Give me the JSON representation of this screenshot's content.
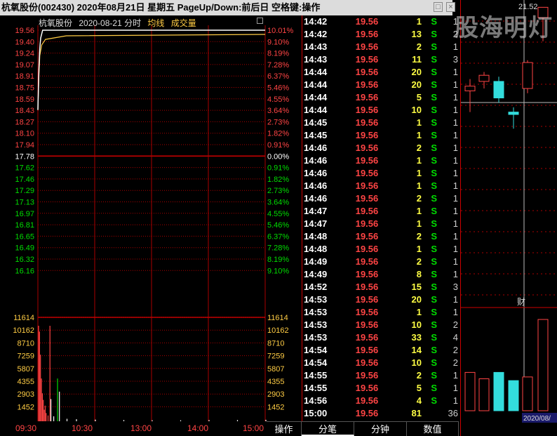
{
  "window": {
    "title": "杭氧股份(002430)  2020年08月21日 星期五 PageUp/Down:前后日 空格键:操作",
    "restore_glyph": "□",
    "close_glyph": "×"
  },
  "chart_header": {
    "stock_name": "杭氧股份",
    "date_label": "2020-08-21 分时",
    "avg_label": "均线",
    "volume_label": "成交量"
  },
  "colors": {
    "up": "#ff4444",
    "down": "#00dd00",
    "flat": "#ffffff",
    "price_line": "#ffffff",
    "avg_line": "#ffcc44",
    "grid": "#aa0000",
    "volume_bar": "#ffffff"
  },
  "price_axis": {
    "left": [
      "19.56",
      "19.40",
      "19.24",
      "19.07",
      "18.91",
      "18.75",
      "18.59",
      "18.43",
      "18.27",
      "18.10",
      "17.94",
      "17.78",
      "17.62",
      "17.46",
      "17.29",
      "17.13",
      "16.97",
      "16.81",
      "16.65",
      "16.49",
      "16.32",
      "16.16"
    ],
    "right": [
      "10.01%",
      "9.10%",
      "8.19%",
      "7.28%",
      "6.37%",
      "5.46%",
      "4.55%",
      "3.64%",
      "2.73%",
      "1.82%",
      "0.91%",
      "0.00%",
      "0.91%",
      "1.82%",
      "2.73%",
      "3.64%",
      "4.55%",
      "5.46%",
      "6.37%",
      "7.28%",
      "8.19%",
      "9.10%"
    ],
    "prev_close_index": 11
  },
  "volume_axis": [
    "11614",
    "10162",
    "8710",
    "7259",
    "5807",
    "4355",
    "2903",
    "1452"
  ],
  "time_axis": [
    "09:30",
    "10:30",
    "13:00",
    "14:00",
    "15:00"
  ],
  "chart_data": {
    "type": "line",
    "price_range": [
      16.0,
      19.56
    ],
    "prev_close": 17.78,
    "price_series": [
      [
        0,
        18.43
      ],
      [
        1,
        19.0
      ],
      [
        2,
        19.3
      ],
      [
        3,
        19.45
      ],
      [
        5,
        19.56
      ],
      [
        240,
        19.56
      ]
    ],
    "avg_series": [
      [
        0,
        18.43
      ],
      [
        1,
        18.9
      ],
      [
        2,
        19.2
      ],
      [
        4,
        19.35
      ],
      [
        8,
        19.43
      ],
      [
        30,
        19.48
      ],
      [
        240,
        19.5
      ]
    ],
    "volume_max": 11614,
    "volume_bars": [
      [
        0,
        11614
      ],
      [
        1,
        10900
      ],
      [
        2,
        8100
      ],
      [
        3,
        5200
      ],
      [
        4,
        3400
      ],
      [
        5,
        2600
      ],
      [
        6,
        1400
      ],
      [
        7,
        1900
      ],
      [
        8,
        1000
      ],
      [
        10,
        700
      ],
      [
        12,
        11614
      ],
      [
        13,
        2700
      ],
      [
        16,
        600
      ],
      [
        20,
        5200
      ],
      [
        22,
        3600
      ],
      [
        30,
        300
      ],
      [
        40,
        250
      ],
      [
        60,
        200
      ],
      [
        90,
        150
      ],
      [
        120,
        120
      ],
      [
        150,
        120
      ],
      [
        180,
        150
      ],
      [
        210,
        150
      ],
      [
        240,
        180
      ]
    ]
  },
  "bottom_tabs": [
    "操作",
    "分笔",
    "分钟",
    "数值"
  ],
  "ticks": [
    {
      "time": "14:42",
      "price": "19.56",
      "vol": "1",
      "side": "S",
      "count": "1"
    },
    {
      "time": "14:42",
      "price": "19.56",
      "vol": "13",
      "side": "S",
      "count": "2"
    },
    {
      "time": "14:43",
      "price": "19.56",
      "vol": "2",
      "side": "S",
      "count": "1"
    },
    {
      "time": "14:43",
      "price": "19.56",
      "vol": "11",
      "side": "S",
      "count": "3"
    },
    {
      "time": "14:44",
      "price": "19.56",
      "vol": "20",
      "side": "S",
      "count": "1"
    },
    {
      "time": "14:44",
      "price": "19.56",
      "vol": "20",
      "side": "S",
      "count": "1"
    },
    {
      "time": "14:44",
      "price": "19.56",
      "vol": "5",
      "side": "S",
      "count": "1"
    },
    {
      "time": "14:44",
      "price": "19.56",
      "vol": "10",
      "side": "S",
      "count": "1"
    },
    {
      "time": "14:45",
      "price": "19.56",
      "vol": "1",
      "side": "S",
      "count": "1"
    },
    {
      "time": "14:45",
      "price": "19.56",
      "vol": "1",
      "side": "S",
      "count": "1"
    },
    {
      "time": "14:46",
      "price": "19.56",
      "vol": "2",
      "side": "S",
      "count": "1"
    },
    {
      "time": "14:46",
      "price": "19.56",
      "vol": "1",
      "side": "S",
      "count": "1"
    },
    {
      "time": "14:46",
      "price": "19.56",
      "vol": "1",
      "side": "S",
      "count": "1"
    },
    {
      "time": "14:46",
      "price": "19.56",
      "vol": "1",
      "side": "S",
      "count": "1"
    },
    {
      "time": "14:46",
      "price": "19.56",
      "vol": "2",
      "side": "S",
      "count": "1"
    },
    {
      "time": "14:47",
      "price": "19.56",
      "vol": "1",
      "side": "S",
      "count": "1"
    },
    {
      "time": "14:47",
      "price": "19.56",
      "vol": "1",
      "side": "S",
      "count": "1"
    },
    {
      "time": "14:48",
      "price": "19.56",
      "vol": "2",
      "side": "S",
      "count": "1"
    },
    {
      "time": "14:48",
      "price": "19.56",
      "vol": "1",
      "side": "S",
      "count": "1"
    },
    {
      "time": "14:49",
      "price": "19.56",
      "vol": "2",
      "side": "S",
      "count": "1"
    },
    {
      "time": "14:49",
      "price": "19.56",
      "vol": "8",
      "side": "S",
      "count": "1"
    },
    {
      "time": "14:52",
      "price": "19.56",
      "vol": "15",
      "side": "S",
      "count": "3"
    },
    {
      "time": "14:53",
      "price": "19.56",
      "vol": "20",
      "side": "S",
      "count": "1"
    },
    {
      "time": "14:53",
      "price": "19.56",
      "vol": "1",
      "side": "S",
      "count": "1"
    },
    {
      "time": "14:53",
      "price": "19.56",
      "vol": "10",
      "side": "S",
      "count": "2"
    },
    {
      "time": "14:53",
      "price": "19.56",
      "vol": "33",
      "side": "S",
      "count": "4"
    },
    {
      "time": "14:54",
      "price": "19.56",
      "vol": "14",
      "side": "S",
      "count": "2"
    },
    {
      "time": "14:54",
      "price": "19.56",
      "vol": "10",
      "side": "S",
      "count": "2"
    },
    {
      "time": "14:55",
      "price": "19.56",
      "vol": "2",
      "side": "S",
      "count": "1"
    },
    {
      "time": "14:55",
      "price": "19.56",
      "vol": "5",
      "side": "S",
      "count": "1"
    },
    {
      "time": "14:56",
      "price": "19.56",
      "vol": "4",
      "side": "S",
      "count": "1"
    },
    {
      "time": "15:00",
      "price": "19.56",
      "vol": "81",
      "side": "",
      "count": "36"
    }
  ],
  "side_panel": {
    "top_price": "21.52",
    "watermark": "股海明灯",
    "marker": "财",
    "date_label": "2020/08/",
    "candles": [
      {
        "open": 19.75,
        "close": 19.85,
        "high": 20.0,
        "low": 19.3,
        "color": "up"
      },
      {
        "open": 19.95,
        "close": 20.08,
        "high": 20.15,
        "low": 19.8,
        "color": "up"
      },
      {
        "open": 19.95,
        "close": 19.6,
        "high": 20.05,
        "low": 19.5,
        "color": "down"
      },
      {
        "open": 19.3,
        "close": 19.25,
        "high": 19.4,
        "low": 18.95,
        "color": "down"
      },
      {
        "open": 19.8,
        "close": 20.35,
        "high": 20.4,
        "low": 19.7,
        "color": "up"
      },
      {
        "open": 21.3,
        "close": 21.52,
        "high": 21.52,
        "low": 20.8,
        "color": "up"
      }
    ],
    "volumes": [
      {
        "v": 0.42,
        "color": "up"
      },
      {
        "v": 0.35,
        "color": "up"
      },
      {
        "v": 0.42,
        "color": "down"
      },
      {
        "v": 0.33,
        "color": "down"
      },
      {
        "v": 0.37,
        "color": "up"
      },
      {
        "v": 1.0,
        "color": "up"
      }
    ]
  }
}
